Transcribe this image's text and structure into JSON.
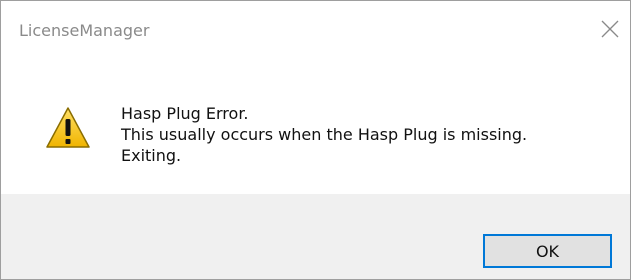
{
  "window": {
    "title": "LicenseManager",
    "close_icon": "close-icon"
  },
  "message": {
    "icon": "warning-icon",
    "lines": [
      "Hasp Plug Error.",
      "This usually occurs when the Hasp Plug is missing.",
      "Exiting."
    ]
  },
  "buttons": {
    "ok_label": "OK"
  },
  "colors": {
    "accent": "#0078d7",
    "warning_fill": "#f5c518",
    "title_text": "#8a8a8a",
    "footer_bg": "#f0f0f0"
  }
}
